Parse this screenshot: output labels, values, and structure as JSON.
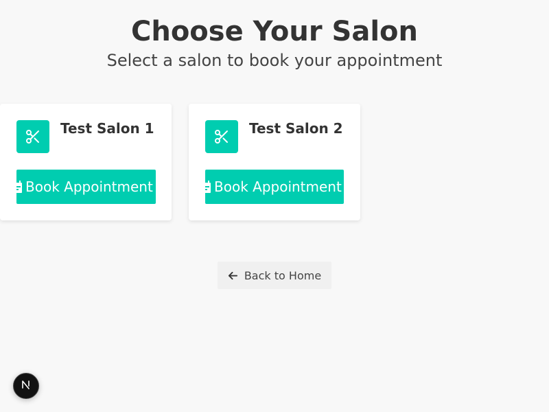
{
  "header": {
    "title": "Choose Your Salon",
    "subtitle": "Select a salon to book your appointment"
  },
  "salons": [
    {
      "name": "Test Salon 1",
      "button_label": "Book Appointment",
      "icon": "scissors-icon"
    },
    {
      "name": "Test Salon 2",
      "button_label": "Book Appointment",
      "icon": "scissors-icon"
    }
  ],
  "back_button": {
    "label": "Back to Home",
    "icon": "arrow-left-icon"
  },
  "dev_badge": {
    "label": "N",
    "icon": "next-logo-icon"
  },
  "colors": {
    "accent": "#00cdb0",
    "background": "#f8f8f8",
    "card": "#ffffff",
    "text": "#333333"
  }
}
